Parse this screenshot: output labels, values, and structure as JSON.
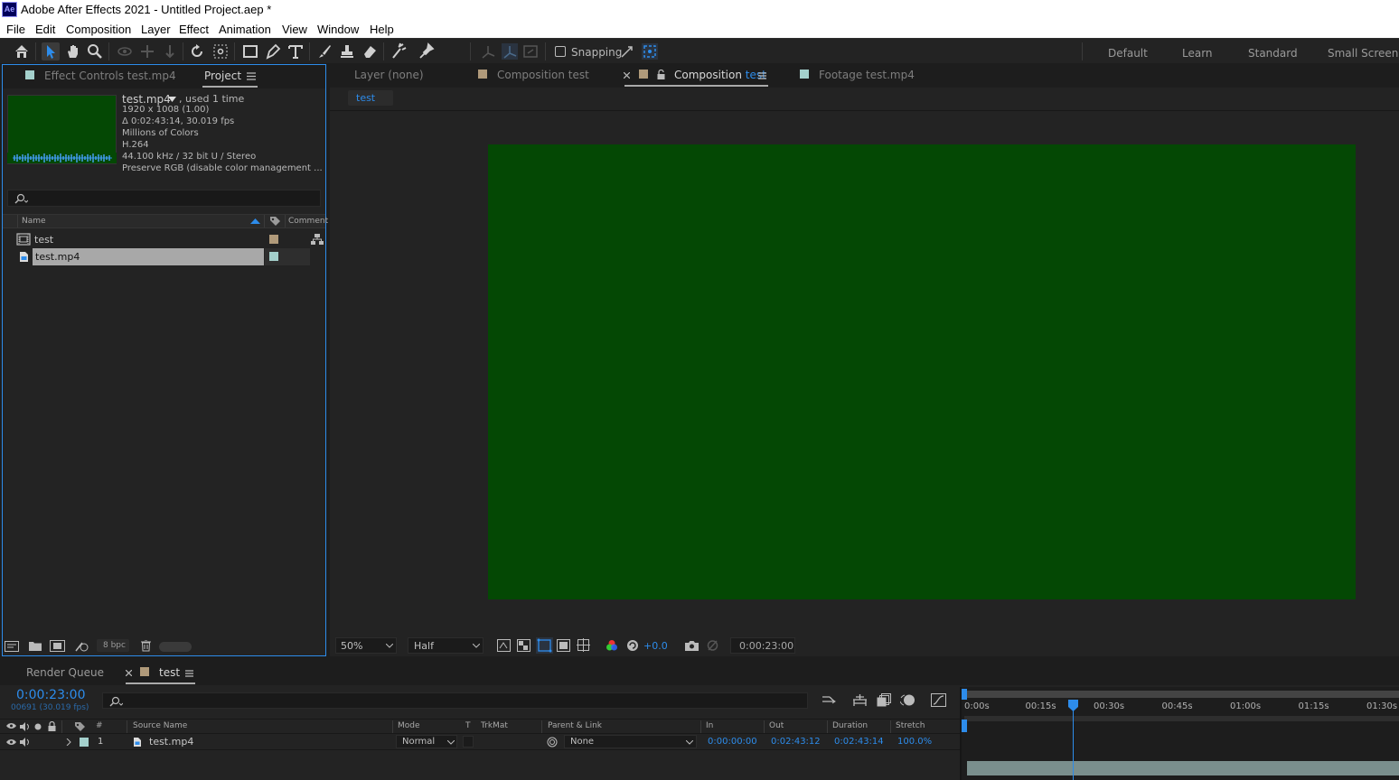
{
  "window": {
    "logo": "Ae",
    "title": "Adobe After Effects 2021 - Untitled Project.aep *"
  },
  "menu": [
    "File",
    "Edit",
    "Composition",
    "Layer",
    "Effect",
    "Animation",
    "View",
    "Window",
    "Help"
  ],
  "toolbar": {
    "snapping_label": "Snapping",
    "workspaces": [
      "Default",
      "Learn",
      "Standard",
      "Small Screen"
    ]
  },
  "project_panel": {
    "tabs": {
      "effect_controls": "Effect Controls test.mp4",
      "project": "Project"
    },
    "info": {
      "name": "test.mp4",
      "used": ", used 1 time",
      "dimensions": "1920 x 1008 (1.00)",
      "duration": "Δ 0:02:43:14, 30.019 fps",
      "colors": "Millions of Colors",
      "codec": "H.264",
      "audio": "44.100 kHz / 32 bit U / Stereo",
      "color_mgmt": "Preserve RGB (disable color management ..."
    },
    "columns": {
      "name": "Name",
      "comment": "Comment"
    },
    "items": [
      {
        "name": "test",
        "type": "composition",
        "label_color": "#b09a7a"
      },
      {
        "name": "test.mp4",
        "type": "footage",
        "label_color": "#a4d0cc"
      }
    ],
    "bpc": "8 bpc"
  },
  "viewer": {
    "tabs": {
      "layer": "Layer (none)",
      "comp_inactive": "Composition test",
      "comp_active_prefix": "Composition ",
      "comp_active_name": "test",
      "footage": "Footage test.mp4"
    },
    "breadcrumb": "test",
    "frame_color": "#044804",
    "zoom": "50%",
    "resolution": "Half",
    "exposure": "+0.0",
    "timecode": "0:00:23:00"
  },
  "timeline": {
    "tabs": {
      "render_queue": "Render Queue",
      "comp": "test"
    },
    "current_time": "0:00:23:00",
    "frame_info": "00691 (30.019 fps)",
    "columns": {
      "hash": "#",
      "source_name": "Source Name",
      "mode": "Mode",
      "t": "T",
      "trkmat": "TrkMat",
      "parent": "Parent & Link",
      "in": "In",
      "out": "Out",
      "duration": "Duration",
      "stretch": "Stretch"
    },
    "ruler": [
      "0:00s",
      "00:15s",
      "00:30s",
      "00:45s",
      "01:00s",
      "01:15s",
      "01:30s"
    ],
    "playhead_seconds": 23,
    "layer": {
      "index": "1",
      "name": "test.mp4",
      "mode": "Normal",
      "parent": "None",
      "in": "0:00:00:00",
      "out": "0:02:43:12",
      "duration": "0:02:43:14",
      "stretch": "100.0%"
    }
  }
}
